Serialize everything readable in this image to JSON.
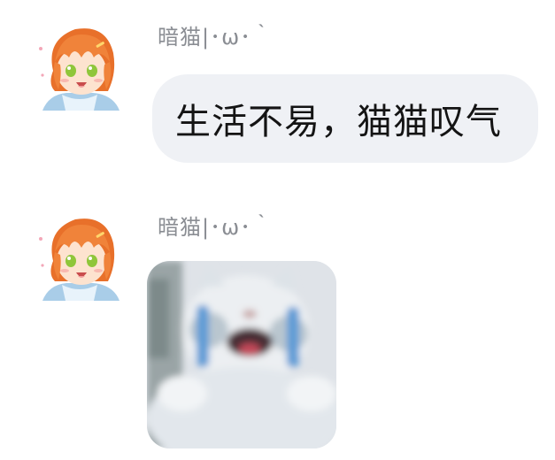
{
  "messages": [
    {
      "sender": "暗猫|･ω･｀",
      "text": "生活不易，猫猫叹气",
      "avatar_icon": "anime-girl-orange-hair-avatar"
    },
    {
      "sender": "暗猫|･ω･｀",
      "sticker_icon": "crying-cat-sticker",
      "avatar_icon": "anime-girl-orange-hair-avatar"
    }
  ],
  "colors": {
    "bubble_bg": "#eff1f5",
    "sender_text": "#8a8d93",
    "message_text": "#141414",
    "hair": "#f0833a",
    "eyes": "#8fc63a"
  }
}
